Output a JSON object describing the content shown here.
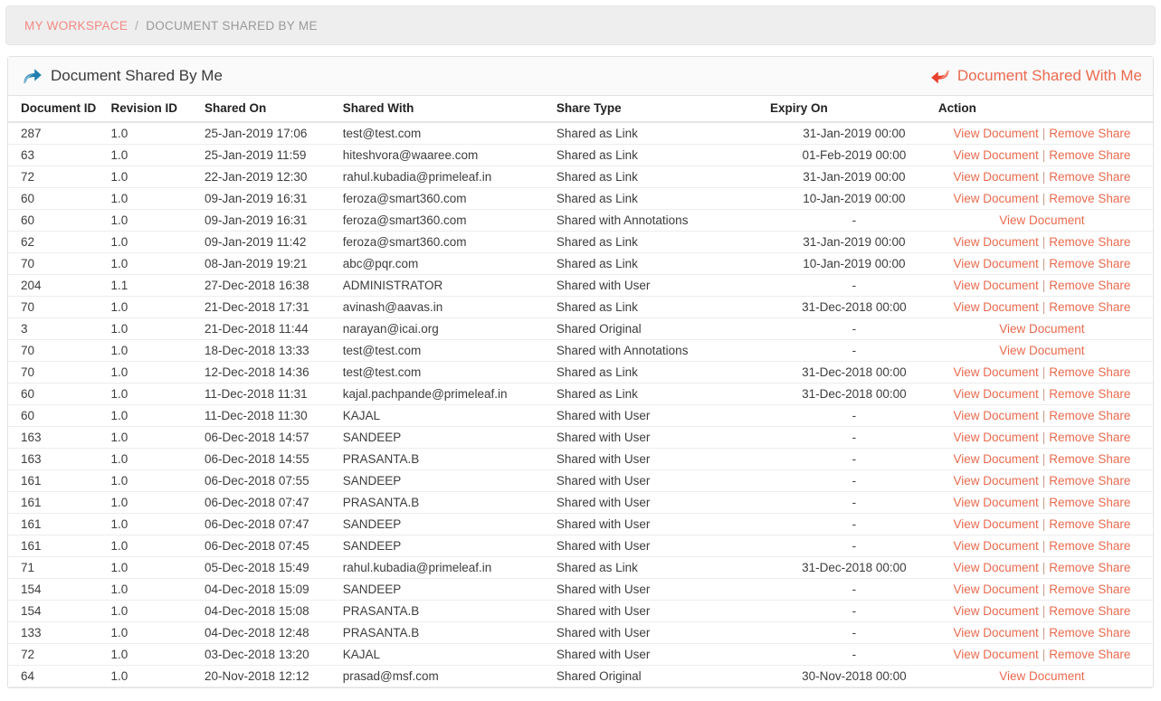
{
  "breadcrumb": {
    "root_label": "MY WORKSPACE",
    "separator": "/",
    "current_label": "DOCUMENT SHARED BY ME"
  },
  "panel": {
    "title": "Document Shared By Me",
    "title_icon": "share-arrow-icon",
    "right_link_label": "Document Shared With Me",
    "right_link_icon": "reply-arrow-icon"
  },
  "colors": {
    "link_red": "#ea6a4e",
    "breadcrumb_link": "#f28a83",
    "title_icon_blue": "#1f7fb0",
    "right_icon_red": "#e8402c",
    "panel_head_bg": "#fafafa",
    "breadcrumb_bg": "#eeeeee"
  },
  "table": {
    "columns": [
      "Document ID",
      "Revision ID",
      "Shared On",
      "Shared With",
      "Share Type",
      "Expiry On",
      "Action"
    ],
    "actions": {
      "view_label": "View Document",
      "remove_label": "Remove Share",
      "separator": "|"
    },
    "rows": [
      {
        "document_id": "287",
        "revision_id": "1.0",
        "shared_on": "25-Jan-2019 17:06",
        "shared_with": "test@test.com",
        "share_type": "Shared as Link",
        "expiry_on": "31-Jan-2019 00:00",
        "has_remove": true
      },
      {
        "document_id": "63",
        "revision_id": "1.0",
        "shared_on": "25-Jan-2019 11:59",
        "shared_with": "hiteshvora@waaree.com",
        "share_type": "Shared as Link",
        "expiry_on": "01-Feb-2019 00:00",
        "has_remove": true
      },
      {
        "document_id": "72",
        "revision_id": "1.0",
        "shared_on": "22-Jan-2019 12:30",
        "shared_with": "rahul.kubadia@primeleaf.in",
        "share_type": "Shared as Link",
        "expiry_on": "31-Jan-2019 00:00",
        "has_remove": true
      },
      {
        "document_id": "60",
        "revision_id": "1.0",
        "shared_on": "09-Jan-2019 16:31",
        "shared_with": "feroza@smart360.com",
        "share_type": "Shared as Link",
        "expiry_on": "10-Jan-2019 00:00",
        "has_remove": true
      },
      {
        "document_id": "60",
        "revision_id": "1.0",
        "shared_on": "09-Jan-2019 16:31",
        "shared_with": "feroza@smart360.com",
        "share_type": "Shared with Annotations",
        "expiry_on": "-",
        "has_remove": false
      },
      {
        "document_id": "62",
        "revision_id": "1.0",
        "shared_on": "09-Jan-2019 11:42",
        "shared_with": "feroza@smart360.com",
        "share_type": "Shared as Link",
        "expiry_on": "31-Jan-2019 00:00",
        "has_remove": true
      },
      {
        "document_id": "70",
        "revision_id": "1.0",
        "shared_on": "08-Jan-2019 19:21",
        "shared_with": "abc@pqr.com",
        "share_type": "Shared as Link",
        "expiry_on": "10-Jan-2019 00:00",
        "has_remove": true
      },
      {
        "document_id": "204",
        "revision_id": "1.1",
        "shared_on": "27-Dec-2018 16:38",
        "shared_with": "ADMINISTRATOR",
        "share_type": "Shared with User",
        "expiry_on": "-",
        "has_remove": true
      },
      {
        "document_id": "70",
        "revision_id": "1.0",
        "shared_on": "21-Dec-2018 17:31",
        "shared_with": "avinash@aavas.in",
        "share_type": "Shared as Link",
        "expiry_on": "31-Dec-2018 00:00",
        "has_remove": true
      },
      {
        "document_id": "3",
        "revision_id": "1.0",
        "shared_on": "21-Dec-2018 11:44",
        "shared_with": "narayan@icai.org",
        "share_type": "Shared Original",
        "expiry_on": "-",
        "has_remove": false
      },
      {
        "document_id": "70",
        "revision_id": "1.0",
        "shared_on": "18-Dec-2018 13:33",
        "shared_with": "test@test.com",
        "share_type": "Shared with Annotations",
        "expiry_on": "-",
        "has_remove": false
      },
      {
        "document_id": "70",
        "revision_id": "1.0",
        "shared_on": "12-Dec-2018 14:36",
        "shared_with": "test@test.com",
        "share_type": "Shared as Link",
        "expiry_on": "31-Dec-2018 00:00",
        "has_remove": true
      },
      {
        "document_id": "60",
        "revision_id": "1.0",
        "shared_on": "11-Dec-2018 11:31",
        "shared_with": "kajal.pachpande@primeleaf.in",
        "share_type": "Shared as Link",
        "expiry_on": "31-Dec-2018 00:00",
        "has_remove": true
      },
      {
        "document_id": "60",
        "revision_id": "1.0",
        "shared_on": "11-Dec-2018 11:30",
        "shared_with": "KAJAL",
        "share_type": "Shared with User",
        "expiry_on": "-",
        "has_remove": true
      },
      {
        "document_id": "163",
        "revision_id": "1.0",
        "shared_on": "06-Dec-2018 14:57",
        "shared_with": "SANDEEP",
        "share_type": "Shared with User",
        "expiry_on": "-",
        "has_remove": true
      },
      {
        "document_id": "163",
        "revision_id": "1.0",
        "shared_on": "06-Dec-2018 14:55",
        "shared_with": "PRASANTA.B",
        "share_type": "Shared with User",
        "expiry_on": "-",
        "has_remove": true
      },
      {
        "document_id": "161",
        "revision_id": "1.0",
        "shared_on": "06-Dec-2018 07:55",
        "shared_with": "SANDEEP",
        "share_type": "Shared with User",
        "expiry_on": "-",
        "has_remove": true
      },
      {
        "document_id": "161",
        "revision_id": "1.0",
        "shared_on": "06-Dec-2018 07:47",
        "shared_with": "PRASANTA.B",
        "share_type": "Shared with User",
        "expiry_on": "-",
        "has_remove": true
      },
      {
        "document_id": "161",
        "revision_id": "1.0",
        "shared_on": "06-Dec-2018 07:47",
        "shared_with": "SANDEEP",
        "share_type": "Shared with User",
        "expiry_on": "-",
        "has_remove": true
      },
      {
        "document_id": "161",
        "revision_id": "1.0",
        "shared_on": "06-Dec-2018 07:45",
        "shared_with": "SANDEEP",
        "share_type": "Shared with User",
        "expiry_on": "-",
        "has_remove": true
      },
      {
        "document_id": "71",
        "revision_id": "1.0",
        "shared_on": "05-Dec-2018 15:49",
        "shared_with": "rahul.kubadia@primeleaf.in",
        "share_type": "Shared as Link",
        "expiry_on": "31-Dec-2018 00:00",
        "has_remove": true
      },
      {
        "document_id": "154",
        "revision_id": "1.0",
        "shared_on": "04-Dec-2018 15:09",
        "shared_with": "SANDEEP",
        "share_type": "Shared with User",
        "expiry_on": "-",
        "has_remove": true
      },
      {
        "document_id": "154",
        "revision_id": "1.0",
        "shared_on": "04-Dec-2018 15:08",
        "shared_with": "PRASANTA.B",
        "share_type": "Shared with User",
        "expiry_on": "-",
        "has_remove": true
      },
      {
        "document_id": "133",
        "revision_id": "1.0",
        "shared_on": "04-Dec-2018 12:48",
        "shared_with": "PRASANTA.B",
        "share_type": "Shared with User",
        "expiry_on": "-",
        "has_remove": true
      },
      {
        "document_id": "72",
        "revision_id": "1.0",
        "shared_on": "03-Dec-2018 13:20",
        "shared_with": "KAJAL",
        "share_type": "Shared with User",
        "expiry_on": "-",
        "has_remove": true
      },
      {
        "document_id": "64",
        "revision_id": "1.0",
        "shared_on": "20-Nov-2018 12:12",
        "shared_with": "prasad@msf.com",
        "share_type": "Shared Original",
        "expiry_on": "30-Nov-2018 00:00",
        "has_remove": false
      }
    ]
  }
}
